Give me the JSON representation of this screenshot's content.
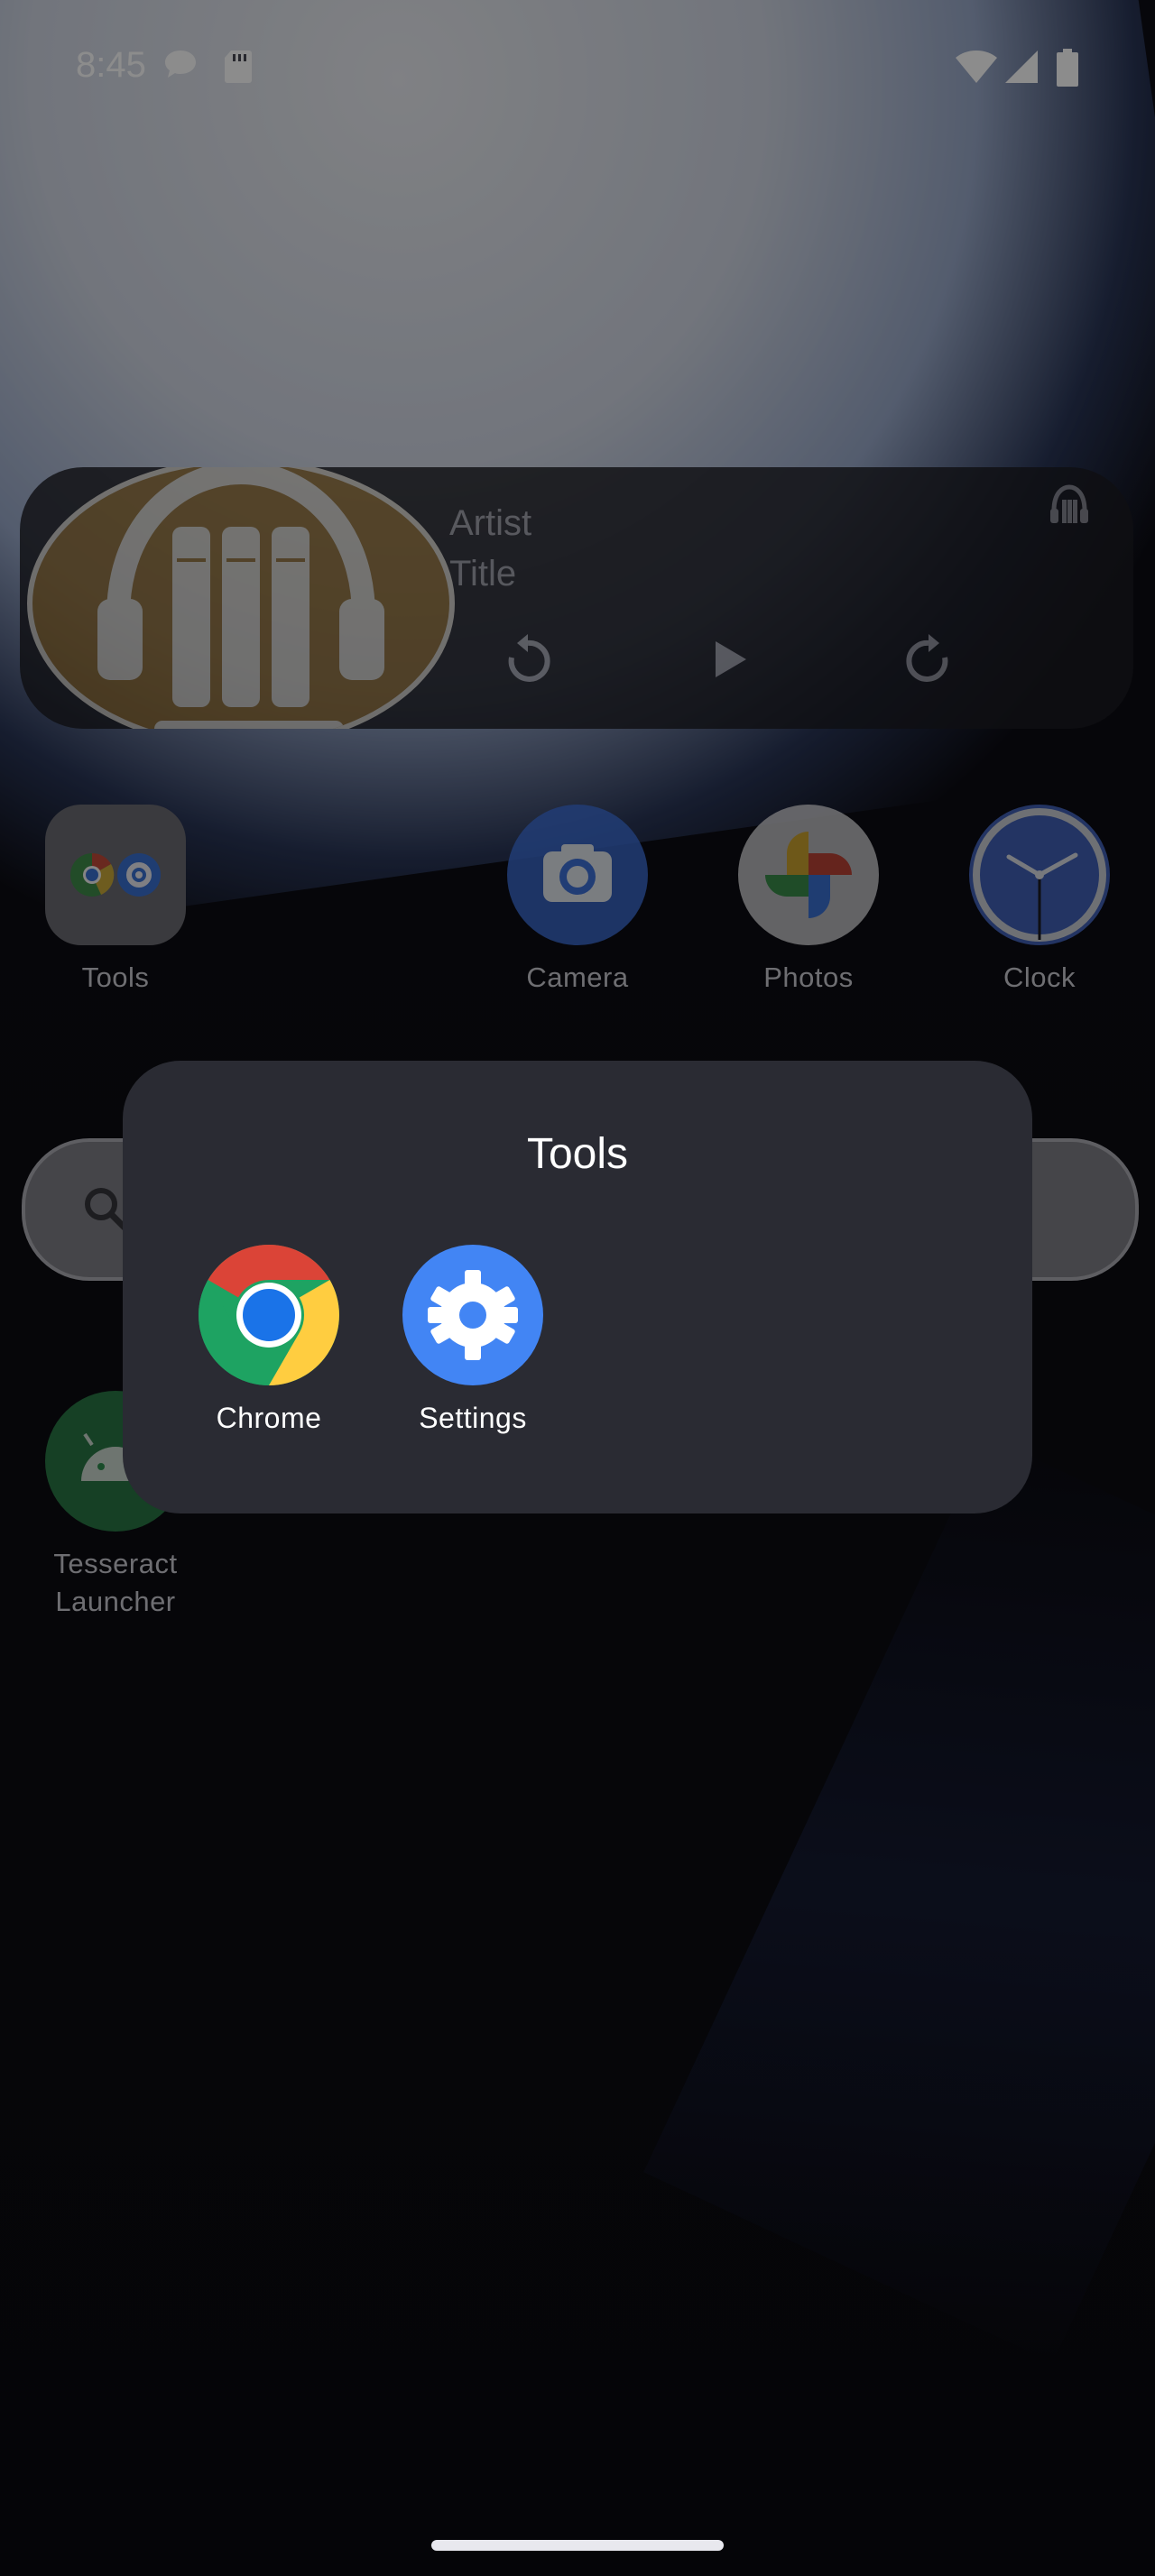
{
  "status_bar": {
    "time": "8:45",
    "icons": [
      "chat-bubble-icon",
      "sd-card-icon",
      "wifi-icon",
      "signal-icon",
      "battery-icon"
    ]
  },
  "media_widget": {
    "artist": "Artist",
    "title": "Title",
    "controls": [
      "rewind-icon",
      "play-icon",
      "forward-icon"
    ],
    "app_icon": "audiobook-headphones-icon"
  },
  "home": {
    "apps": [
      {
        "label": "Tools",
        "icon": "folder-icon"
      },
      {
        "label": "Camera",
        "icon": "camera-icon"
      },
      {
        "label": "Photos",
        "icon": "photos-pinwheel-icon"
      },
      {
        "label": "Clock",
        "icon": "clock-icon"
      }
    ],
    "launcher_app": {
      "label_line1": "Tesseract",
      "label_line2": "Launcher",
      "icon": "android-icon"
    }
  },
  "folder": {
    "title": "Tools",
    "apps": [
      {
        "label": "Chrome",
        "icon": "chrome-icon"
      },
      {
        "label": "Settings",
        "icon": "settings-gear-icon"
      }
    ]
  },
  "colors": {
    "folder_bg": "#2a2b33",
    "settings_blue": "#4285f4",
    "camera_blue": "#3d6fd6",
    "clock_blue": "#4a6fd1"
  }
}
